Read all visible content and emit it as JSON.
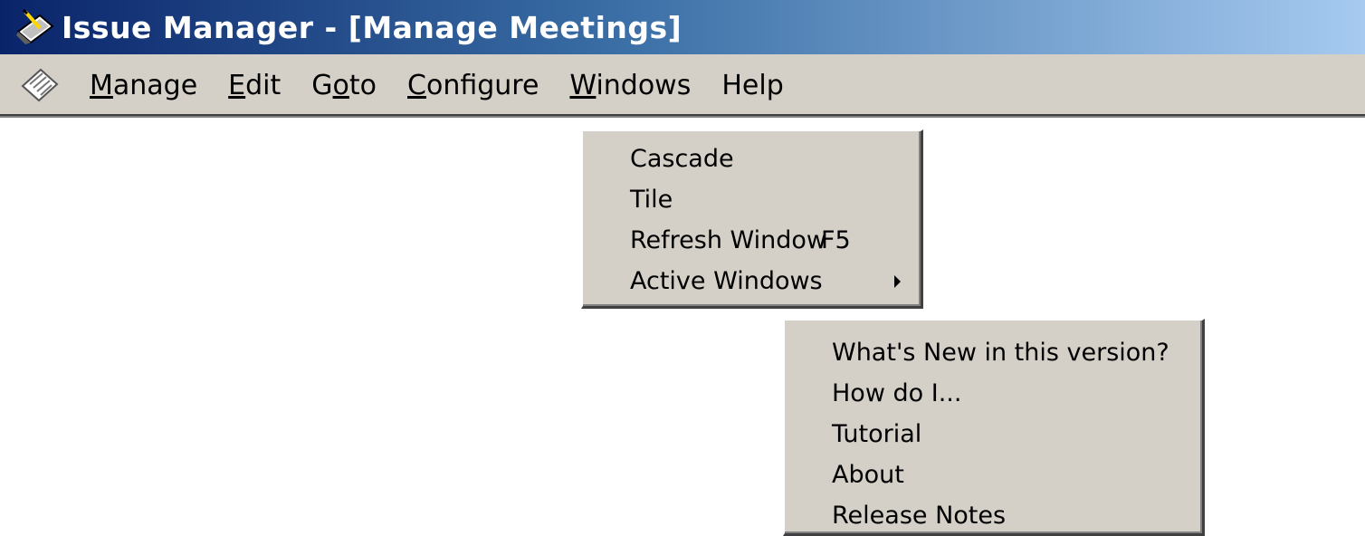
{
  "window": {
    "title": "Issue Manager - [Manage Meetings]"
  },
  "menubar": {
    "items": [
      {
        "pre": "",
        "key": "M",
        "post": "anage"
      },
      {
        "pre": "",
        "key": "E",
        "post": "dit"
      },
      {
        "pre": "G",
        "key": "o",
        "post": "to"
      },
      {
        "pre": "",
        "key": "C",
        "post": "onfigure"
      },
      {
        "pre": "",
        "key": "W",
        "post": "indows"
      },
      {
        "pre": "Help",
        "key": "",
        "post": ""
      }
    ]
  },
  "windows_menu": {
    "items": [
      {
        "label": "Cascade"
      },
      {
        "label": "Tile"
      },
      {
        "label": "Refresh Window",
        "shortcut": "F5"
      },
      {
        "label": "Active Windows",
        "submenu": true
      }
    ]
  },
  "help_menu": {
    "items": [
      {
        "label": "What's New in this version?"
      },
      {
        "label": "How do I..."
      },
      {
        "label": "Tutorial"
      },
      {
        "label": "About"
      },
      {
        "label": "Release Notes"
      }
    ]
  },
  "colors": {
    "titlebar_start": "#0a246a",
    "titlebar_end": "#a6caf0",
    "menu_face": "#d4d0c8"
  },
  "icons": {
    "app": "app-icon",
    "mdi_child": "document-icon",
    "submenu": "arrow-right-icon"
  }
}
